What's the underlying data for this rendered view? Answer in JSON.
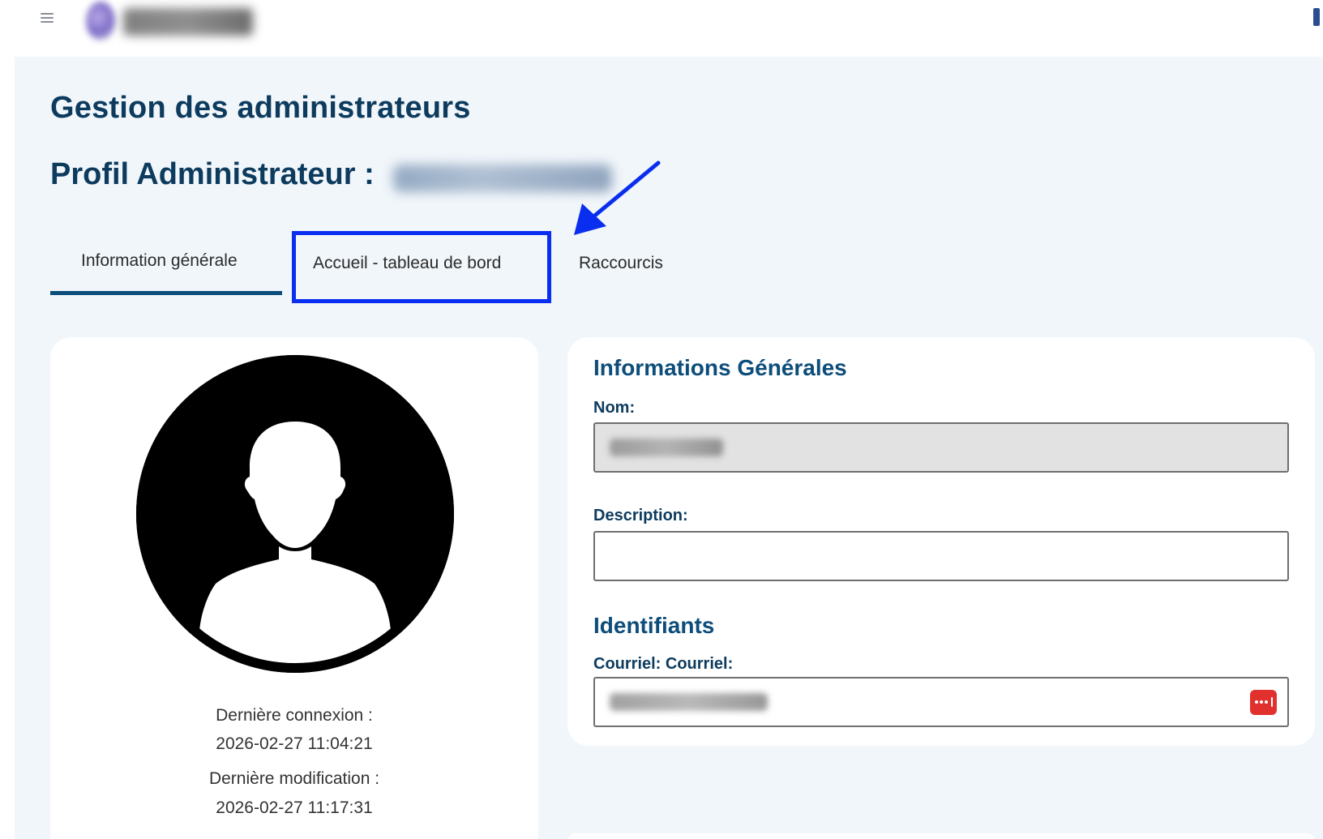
{
  "page": {
    "title": "Gestion des administrateurs",
    "profile_label": "Profil Administrateur :"
  },
  "tabs": [
    {
      "label": "Information générale",
      "active": true
    },
    {
      "label": "Accueil - tableau de bord",
      "active": false,
      "highlighted": true
    },
    {
      "label": "Raccourcis",
      "active": false
    }
  ],
  "profile_card": {
    "last_login_label": "Dernière connexion :",
    "last_login_value": "2026-02-27 11:04:21",
    "last_modified_label": "Dernière modification :",
    "last_modified_value": "2026-02-27 11:17:31"
  },
  "general_info": {
    "section_title": "Informations Générales",
    "nom_label": "Nom:",
    "description_label": "Description:",
    "description_value": ""
  },
  "identifiers": {
    "section_title": "Identifiants",
    "email_label": "Courriel: Courriel:"
  },
  "icons": {
    "menu": "hamburger-menu-icon",
    "avatar": "user-silhouette-icon",
    "password_manager": "password-dots-icon",
    "annotation_arrow": "arrow-icon"
  },
  "colors": {
    "primary": "#0d3b5e",
    "tab_underline": "#0d4d7a",
    "highlight": "#0a2ef0",
    "content_bg": "#f1f6fa",
    "password_icon": "#e0312f"
  }
}
